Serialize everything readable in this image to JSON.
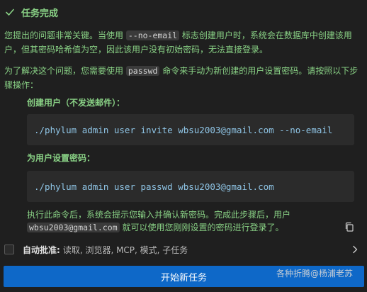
{
  "task": {
    "title": "任务完成"
  },
  "paragraph1": {
    "prefix": "您提出的问题非常关键。当使用",
    "flag": "--no-email",
    "suffix": "标志创建用户时，系统会在数据库中创建该用户，但其密码哈希值为空，因此该用户没有初始密码，无法直接登录。"
  },
  "paragraph2": {
    "prefix": "为了解决这个问题，您需要使用",
    "command": "passwd",
    "suffix": "命令来手动为新创建的用户设置密码。请按照以下步骤操作："
  },
  "steps": [
    {
      "label": "创建用户（不发送邮件）：",
      "code": "./phylum admin user invite wbsu2003@gmail.com --no-email"
    },
    {
      "label": "为用户设置密码：",
      "code": "./phylum admin user passwd wbsu2003@gmail.com"
    }
  ],
  "note": {
    "prefix": "执行此命令后，系统会提示您输入并确认新密码。完成此步骤后，用户",
    "email": "wbsu2003@gmail.com",
    "suffix": "就可以使用您刚刚设置的密码进行登录了。"
  },
  "auto_approve": {
    "label": "自动批准:",
    "items": "读取, 浏览器, MCP, 模式, 子任务"
  },
  "primary_button": {
    "label": "开始新任务"
  },
  "watermark": "各种折腾@杨浦老苏",
  "icons": {
    "check": "check-icon",
    "copy": "copy-icon",
    "chevron": "chevron-right-icon"
  },
  "colors": {
    "success_text": "#89d185",
    "code_text": "#8fc5e6",
    "button_bg": "#0e68c8",
    "background": "#1f1f1f"
  }
}
